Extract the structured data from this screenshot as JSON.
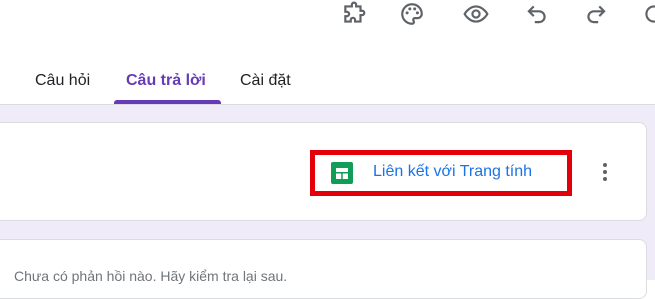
{
  "toolbar": {
    "icons": [
      "add-ons-icon",
      "customize-theme-icon",
      "preview-icon",
      "undo-icon",
      "redo-icon",
      "more-icon"
    ]
  },
  "tabs": [
    {
      "label": "Câu hỏi",
      "active": false
    },
    {
      "label": "Câu trả lời",
      "active": true
    },
    {
      "label": "Cài đặt",
      "active": false
    }
  ],
  "responses": {
    "link_sheets_label": "Liên kết với Trang tính",
    "link_icon": "google-sheets-icon",
    "more_icon": "more-vert-icon",
    "empty_message": "Chưa có phản hồi nào. Hãy kiểm tra lại sau."
  },
  "colors": {
    "accent": "#673ab7",
    "background": "#f0ebf8",
    "link": "#1a73e8",
    "highlight_border": "#e3000b",
    "sheets_green": "#0f9d58"
  }
}
